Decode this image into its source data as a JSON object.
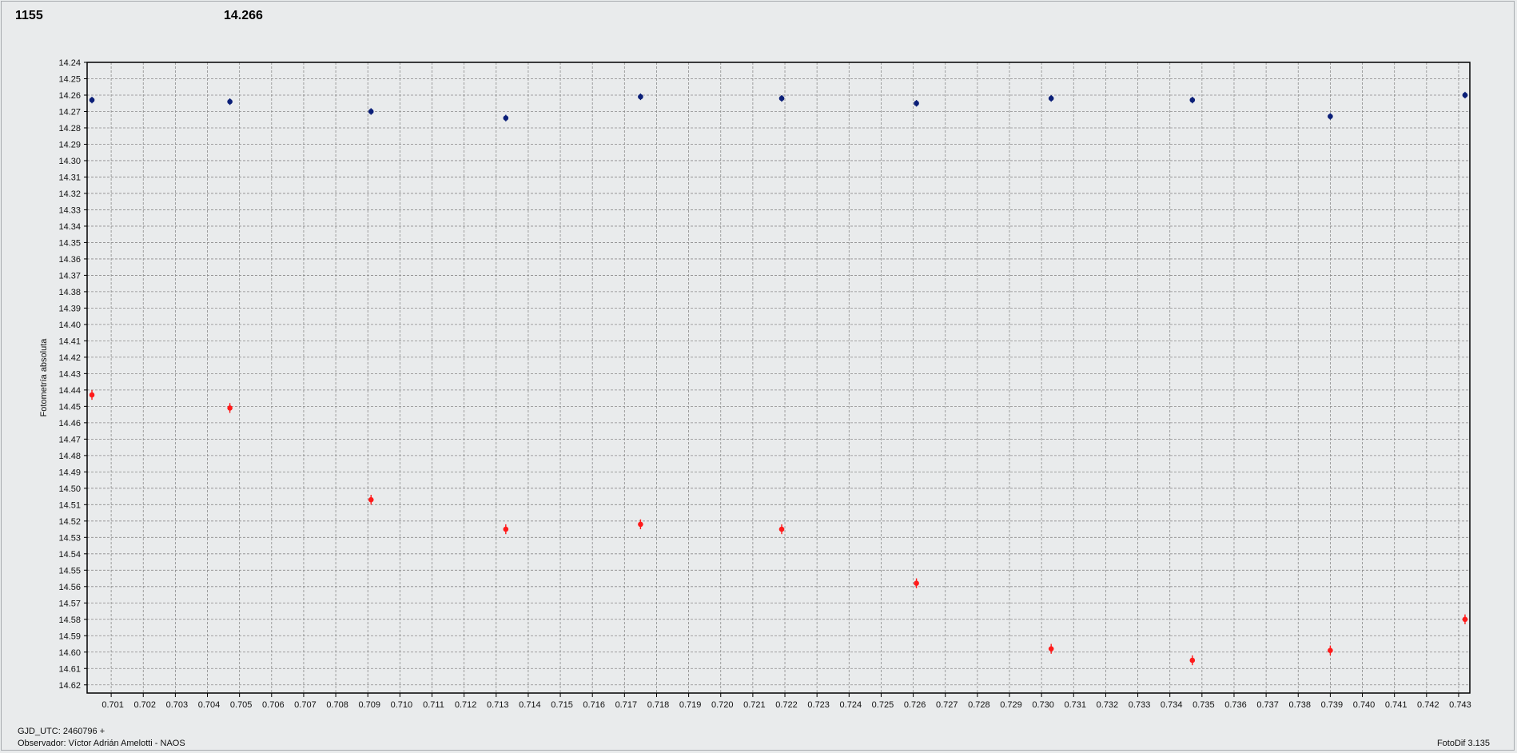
{
  "header": {
    "left_value": "1155",
    "right_value": "14.266"
  },
  "colors": {
    "series_red": "#ff1a1a",
    "series_blue": "#0b1f78",
    "grid": "#8a8a8a",
    "axis": "#000000"
  },
  "footer": {
    "gjd": "GJD_UTC: 2460796 +",
    "observer": "Observador: Víctor Adrián Amelotti - NAOS",
    "version": "FotoDif 3.135"
  },
  "chart_data": {
    "type": "scatter",
    "ylabel": "Fotometría absoluta",
    "xlabel": "",
    "xlim": [
      0.70025,
      0.74335
    ],
    "ylim": [
      14.24,
      14.625
    ],
    "y_inverted": true,
    "grid": true,
    "x_ticks": [
      "0.701",
      "0.702",
      "0.703",
      "0.704",
      "0.705",
      "0.706",
      "0.707",
      "0.708",
      "0.709",
      "0.710",
      "0.711",
      "0.712",
      "0.713",
      "0.714",
      "0.715",
      "0.716",
      "0.717",
      "0.718",
      "0.719",
      "0.720",
      "0.721",
      "0.722",
      "0.723",
      "0.724",
      "0.725",
      "0.726",
      "0.727",
      "0.728",
      "0.729",
      "0.730",
      "0.731",
      "0.732",
      "0.733",
      "0.734",
      "0.735",
      "0.736",
      "0.737",
      "0.738",
      "0.739",
      "0.740",
      "0.741",
      "0.742",
      "0.743"
    ],
    "y_ticks": [
      "14.24",
      "14.25",
      "14.26",
      "14.27",
      "14.28",
      "14.29",
      "14.30",
      "14.31",
      "14.32",
      "14.33",
      "14.34",
      "14.35",
      "14.36",
      "14.37",
      "14.38",
      "14.39",
      "14.40",
      "14.41",
      "14.42",
      "14.43",
      "14.44",
      "14.45",
      "14.46",
      "14.47",
      "14.48",
      "14.49",
      "14.50",
      "14.51",
      "14.52",
      "14.53",
      "14.54",
      "14.55",
      "14.56",
      "14.57",
      "14.58",
      "14.59",
      "14.60",
      "14.61",
      "14.62"
    ],
    "series": [
      {
        "color": "#0b1f78",
        "x": [
          0.7004,
          0.7047,
          0.7091,
          0.7133,
          0.7175,
          0.7219,
          0.7261,
          0.7303,
          0.7347,
          0.739,
          0.7432
        ],
        "y": [
          14.263,
          14.264,
          14.27,
          14.274,
          14.261,
          14.262,
          14.265,
          14.262,
          14.263,
          14.273,
          14.26
        ],
        "err": [
          0.002,
          0.002,
          0.002,
          0.002,
          0.002,
          0.002,
          0.002,
          0.002,
          0.002,
          0.002,
          0.002
        ]
      },
      {
        "color": "#ff1a1a",
        "x": [
          0.7004,
          0.7047,
          0.7091,
          0.7133,
          0.7175,
          0.7219,
          0.7261,
          0.7303,
          0.7347,
          0.739,
          0.7432
        ],
        "y": [
          14.443,
          14.451,
          14.507,
          14.525,
          14.522,
          14.525,
          14.558,
          14.598,
          14.605,
          14.599,
          14.58
        ],
        "err": [
          0.003,
          0.003,
          0.003,
          0.003,
          0.003,
          0.003,
          0.003,
          0.003,
          0.003,
          0.003,
          0.003
        ]
      }
    ]
  }
}
